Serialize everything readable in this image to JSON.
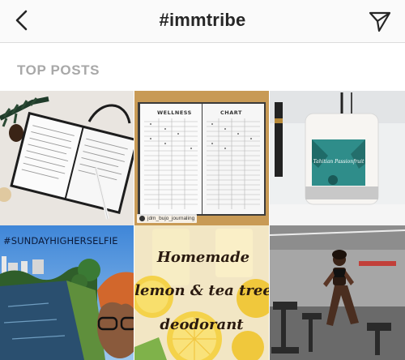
{
  "header": {
    "title": "#immtribe",
    "back_icon": "chevron-left-icon",
    "share_icon": "send-paper-plane-icon"
  },
  "section": {
    "label": "TOP POSTS"
  },
  "posts": [
    {
      "description_icon": "photo",
      "overlay": ""
    },
    {
      "overlay_left": "WELLNESS",
      "overlay_right": "CHART",
      "credit": "jdm_bujo_journaling"
    },
    {
      "candle_label": "Tahitian Passionfruit"
    },
    {
      "overlay": "#SUNDAYHIGHERSELFIE"
    },
    {
      "line1": "Homemade",
      "line2": "lemon & tea tree",
      "line3": "deodorant"
    },
    {
      "overlay": ""
    }
  ],
  "colors": {
    "header_bg": "#fafafa",
    "title": "#262626",
    "section_label": "#a8a8a8",
    "divider": "#dcdcdc"
  }
}
